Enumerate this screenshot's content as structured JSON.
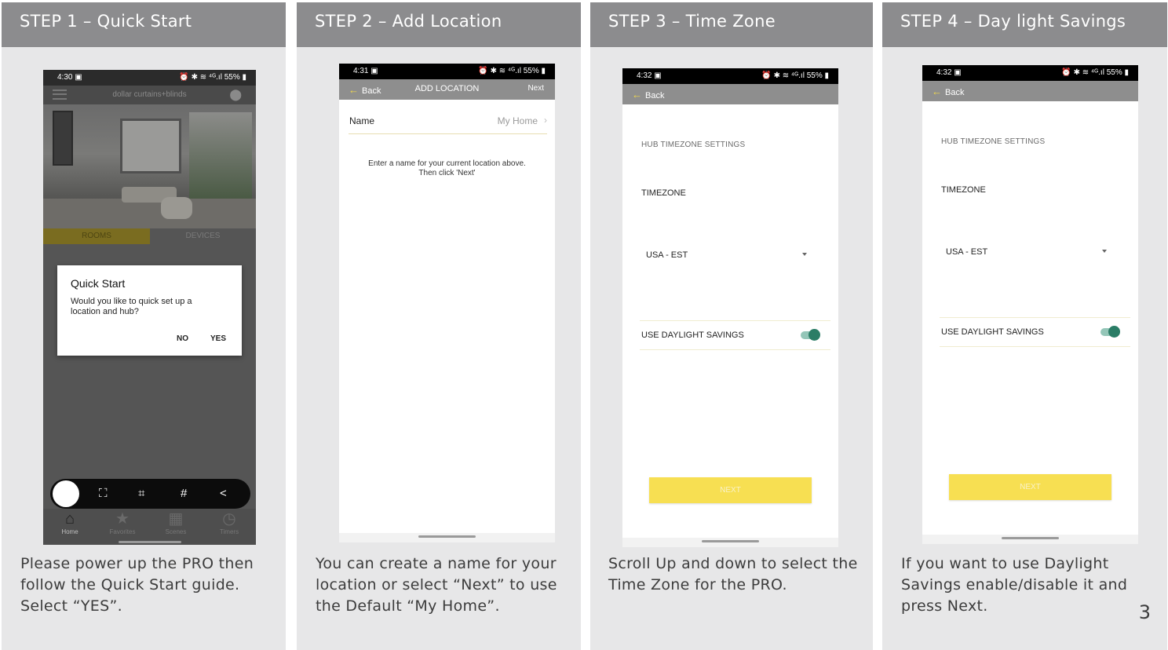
{
  "page_number": "3",
  "steps": [
    {
      "header": "STEP 1 – Quick Start",
      "caption": "Please power up the PRO then follow the Quick Start guide. Select “YES”.",
      "phone": {
        "status_time": "4:30 ▣",
        "status_right": "⏰ ✱ ≋ ⁴ᴳ.ıl 55% ▮",
        "brand": "dollar curtains+blinds",
        "tab_rooms": "ROOMS",
        "tab_devices": "DEVICES",
        "dialog_title": "Quick Start",
        "dialog_message": "Would you like to quick set up a location and hub?",
        "dialog_no": "NO",
        "dialog_yes": "YES",
        "nav": [
          "Home",
          "Favorites",
          "Scenes",
          "Timers"
        ]
      }
    },
    {
      "header": "STEP 2 – Add Location",
      "caption": "You can create a name for your location or select “Next” to use the Default “My Home”.",
      "phone": {
        "status_time": "4:31 ▣",
        "status_right": "⏰ ✱ ≋ ⁴ᴳ.ıl 55% ▮",
        "back": "Back",
        "title": "ADD LOCATION",
        "next": "Next",
        "name_label": "Name",
        "name_value": "My Home",
        "hint_line1": "Enter a name for your current location above.",
        "hint_line2": "Then click 'Next'"
      }
    },
    {
      "header": "STEP 3 – Time Zone",
      "caption": "Scroll Up and down to select the Time Zone for the PRO.",
      "phone": {
        "status_time": "4:32 ▣",
        "status_right": "⏰ ✱ ≋ ⁴ᴳ.ıl 55% ▮",
        "back": "Back",
        "section": "HUB TIMEZONE SETTINGS",
        "timezone_label": "TIMEZONE",
        "timezone_value": "USA - EST",
        "daylight_label": "USE DAYLIGHT SAVINGS",
        "daylight_on": true,
        "next": "NEXT"
      }
    },
    {
      "header": "STEP 4 – Day light Savings",
      "caption": "If you want to use Daylight Savings enable/disable it and press Next.",
      "phone": {
        "status_time": "4:32 ▣",
        "status_right": "⏰ ✱ ≋ ⁴ᴳ.ıl 55% ▮",
        "back": "Back",
        "section": "HUB TIMEZONE SETTINGS",
        "timezone_label": "TIMEZONE",
        "timezone_value": "USA - EST",
        "daylight_label": "USE DAYLIGHT SAVINGS",
        "daylight_on": true,
        "next": "NEXT"
      }
    }
  ],
  "colors": {
    "header_bg": "#8c8c8e",
    "panel_bg": "#e7e7e8",
    "accent_yellow": "#f7df52",
    "toggle_green": "#2b7d66"
  }
}
